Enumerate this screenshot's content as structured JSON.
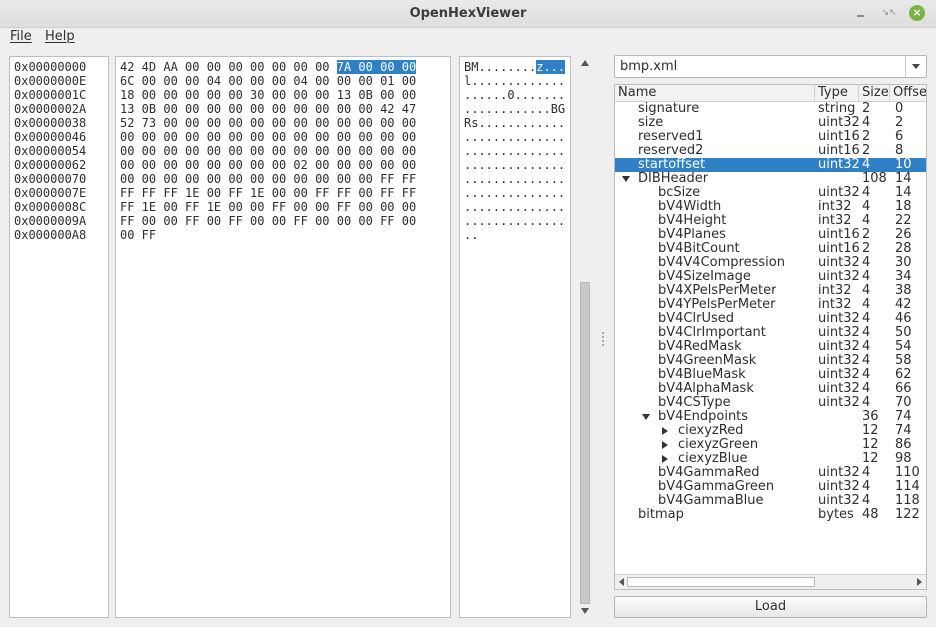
{
  "window": {
    "title": "OpenHexViewer",
    "restore_glyph": "↘↖",
    "close_glyph": "×"
  },
  "menu": {
    "file": "File",
    "help": "Help"
  },
  "offsets": [
    "0x00000000",
    "0x0000000E",
    "0x0000001C",
    "0x0000002A",
    "0x00000038",
    "0x00000046",
    "0x00000054",
    "0x00000062",
    "0x00000070",
    "0x0000007E",
    "0x0000008C",
    "0x0000009A",
    "0x000000A8"
  ],
  "hex_rows": [
    {
      "pre": "42 4D AA 00 00 00 00 00 00 00 ",
      "sel": "7A 00 00 00"
    },
    {
      "pre": "6C 00 00 00 04 00 00 00 04 00 00 00 01 00"
    },
    {
      "pre": "18 00 00 00 00 00 30 00 00 00 13 0B 00 00"
    },
    {
      "pre": "13 0B 00 00 00 00 00 00 00 00 00 00 42 47"
    },
    {
      "pre": "52 73 00 00 00 00 00 00 00 00 00 00 00 00"
    },
    {
      "pre": "00 00 00 00 00 00 00 00 00 00 00 00 00 00"
    },
    {
      "pre": "00 00 00 00 00 00 00 00 00 00 00 00 00 00"
    },
    {
      "pre": "00 00 00 00 00 00 00 00 02 00 00 00 00 00"
    },
    {
      "pre": "00 00 00 00 00 00 00 00 00 00 00 00 FF FF"
    },
    {
      "pre": "FF FF FF 1E 00 FF 1E 00 00 FF FF 00 FF FF"
    },
    {
      "pre": "FF 1E 00 FF 1E 00 00 FF 00 00 FF 00 00 00"
    },
    {
      "pre": "FF 00 00 FF 00 FF 00 00 FF 00 00 00 FF 00"
    },
    {
      "pre": "00 FF"
    }
  ],
  "ascii_rows": [
    {
      "pre": "BM........",
      "sel": "z..."
    },
    {
      "pre": "l............."
    },
    {
      "pre": "......0......."
    },
    {
      "pre": "............BG"
    },
    {
      "pre": "Rs............"
    },
    {
      "pre": ".............."
    },
    {
      "pre": ".............."
    },
    {
      "pre": ".............."
    },
    {
      "pre": ".............."
    },
    {
      "pre": ".............."
    },
    {
      "pre": ".............."
    },
    {
      "pre": ".............."
    },
    {
      "pre": ".."
    }
  ],
  "format_select": {
    "value": "bmp.xml"
  },
  "tree": {
    "columns": [
      "Name",
      "Type",
      "Size",
      "Offset"
    ],
    "rows": [
      {
        "name": "signature",
        "type": "string",
        "size": "2",
        "offset": "0",
        "depth": 1,
        "twisty": ""
      },
      {
        "name": "size",
        "type": "uint32",
        "size": "4",
        "offset": "2",
        "depth": 1,
        "twisty": ""
      },
      {
        "name": "reserved1",
        "type": "uint16",
        "size": "2",
        "offset": "6",
        "depth": 1,
        "twisty": ""
      },
      {
        "name": "reserved2",
        "type": "uint16",
        "size": "2",
        "offset": "8",
        "depth": 1,
        "twisty": ""
      },
      {
        "name": "startoffset",
        "type": "uint32",
        "size": "4",
        "offset": "10",
        "depth": 1,
        "twisty": "",
        "selected": true
      },
      {
        "name": "DIBHeader",
        "type": "",
        "size": "108",
        "offset": "14",
        "depth": 1,
        "twisty": "open"
      },
      {
        "name": "bcSize",
        "type": "uint32",
        "size": "4",
        "offset": "14",
        "depth": 2,
        "twisty": ""
      },
      {
        "name": "bV4Width",
        "type": "int32",
        "size": "4",
        "offset": "18",
        "depth": 2,
        "twisty": ""
      },
      {
        "name": "bV4Height",
        "type": "int32",
        "size": "4",
        "offset": "22",
        "depth": 2,
        "twisty": ""
      },
      {
        "name": "bV4Planes",
        "type": "uint16",
        "size": "2",
        "offset": "26",
        "depth": 2,
        "twisty": ""
      },
      {
        "name": "bV4BitCount",
        "type": "uint16",
        "size": "2",
        "offset": "28",
        "depth": 2,
        "twisty": ""
      },
      {
        "name": "bV4V4Compression",
        "type": "uint32",
        "size": "4",
        "offset": "30",
        "depth": 2,
        "twisty": ""
      },
      {
        "name": "bV4SizeImage",
        "type": "uint32",
        "size": "4",
        "offset": "34",
        "depth": 2,
        "twisty": ""
      },
      {
        "name": "bV4XPelsPerMeter",
        "type": "int32",
        "size": "4",
        "offset": "38",
        "depth": 2,
        "twisty": ""
      },
      {
        "name": "bV4YPelsPerMeter",
        "type": "int32",
        "size": "4",
        "offset": "42",
        "depth": 2,
        "twisty": ""
      },
      {
        "name": "bV4ClrUsed",
        "type": "uint32",
        "size": "4",
        "offset": "46",
        "depth": 2,
        "twisty": ""
      },
      {
        "name": "bV4ClrImportant",
        "type": "uint32",
        "size": "4",
        "offset": "50",
        "depth": 2,
        "twisty": ""
      },
      {
        "name": "bV4RedMask",
        "type": "uint32",
        "size": "4",
        "offset": "54",
        "depth": 2,
        "twisty": ""
      },
      {
        "name": "bV4GreenMask",
        "type": "uint32",
        "size": "4",
        "offset": "58",
        "depth": 2,
        "twisty": ""
      },
      {
        "name": "bV4BlueMask",
        "type": "uint32",
        "size": "4",
        "offset": "62",
        "depth": 2,
        "twisty": ""
      },
      {
        "name": "bV4AlphaMask",
        "type": "uint32",
        "size": "4",
        "offset": "66",
        "depth": 2,
        "twisty": ""
      },
      {
        "name": "bV4CSType",
        "type": "uint32",
        "size": "4",
        "offset": "70",
        "depth": 2,
        "twisty": ""
      },
      {
        "name": "bV4Endpoints",
        "type": "",
        "size": "36",
        "offset": "74",
        "depth": 2,
        "twisty": "open"
      },
      {
        "name": "ciexyzRed",
        "type": "",
        "size": "12",
        "offset": "74",
        "depth": 3,
        "twisty": "closed"
      },
      {
        "name": "ciexyzGreen",
        "type": "",
        "size": "12",
        "offset": "86",
        "depth": 3,
        "twisty": "closed"
      },
      {
        "name": "ciexyzBlue",
        "type": "",
        "size": "12",
        "offset": "98",
        "depth": 3,
        "twisty": "closed"
      },
      {
        "name": "bV4GammaRed",
        "type": "uint32",
        "size": "4",
        "offset": "110",
        "depth": 2,
        "twisty": ""
      },
      {
        "name": "bV4GammaGreen",
        "type": "uint32",
        "size": "4",
        "offset": "114",
        "depth": 2,
        "twisty": ""
      },
      {
        "name": "bV4GammaBlue",
        "type": "uint32",
        "size": "4",
        "offset": "118",
        "depth": 2,
        "twisty": ""
      },
      {
        "name": "bitmap",
        "type": "bytes",
        "size": "48",
        "offset": "122",
        "depth": 1,
        "twisty": ""
      }
    ]
  },
  "load_button": {
    "label": "Load"
  },
  "colors": {
    "selection": "#3080c8",
    "close_button": "#7cb342"
  }
}
